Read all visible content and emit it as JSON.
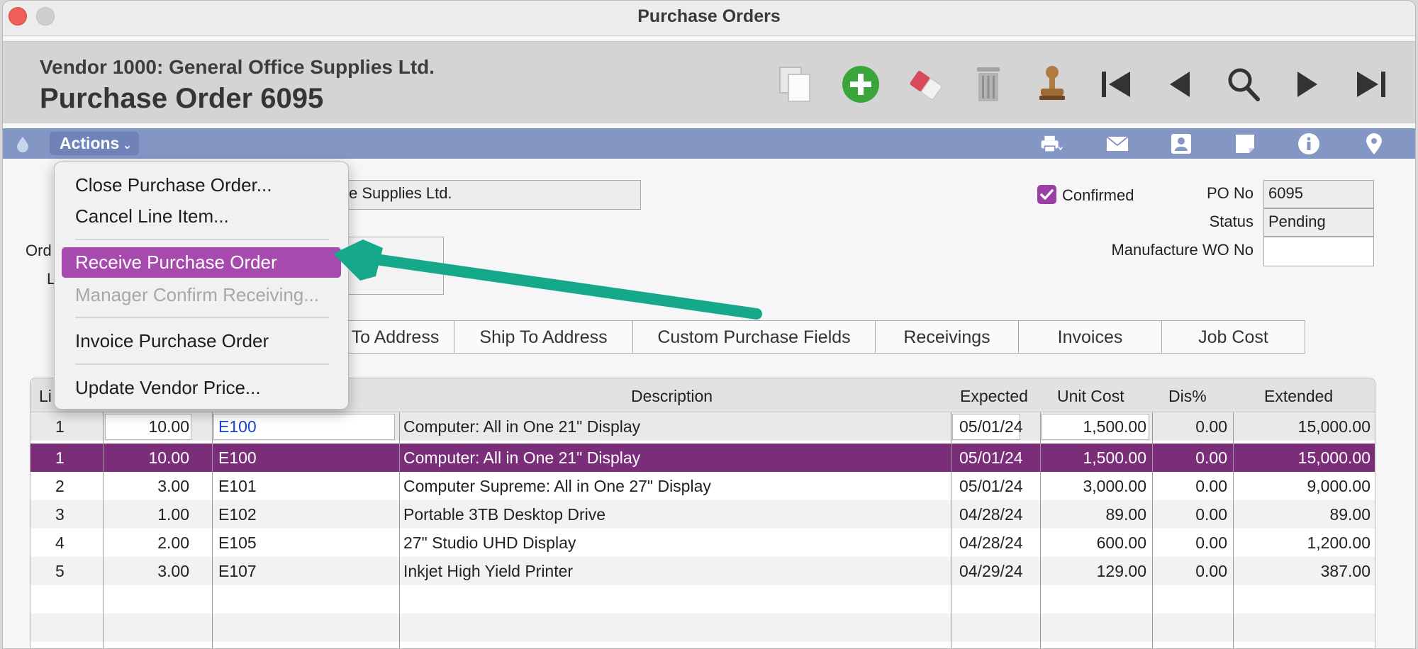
{
  "window": {
    "title": "Purchase Orders"
  },
  "header": {
    "vendor_line": "Vendor 1000: General Office Supplies Ltd.",
    "po_title": "Purchase Order 6095"
  },
  "toolbar": {
    "icons": [
      "duplicate-icon",
      "add-icon",
      "eraser-icon",
      "trash-icon",
      "stamp-icon",
      "first-record-icon",
      "previous-record-icon",
      "search-icon",
      "next-record-icon",
      "last-record-icon"
    ]
  },
  "actionbar": {
    "actions_label": "Actions",
    "icons": [
      "drop-icon",
      "print-icon",
      "mail-icon",
      "contact-icon",
      "note-icon",
      "info-icon",
      "location-icon"
    ]
  },
  "menu": {
    "items": [
      {
        "label": "Close Purchase Order...",
        "enabled": true
      },
      {
        "label": "Cancel Line Item...",
        "enabled": true
      },
      {
        "label": "Receive Purchase Order",
        "enabled": true,
        "highlighted": true
      },
      {
        "label": "Manager Confirm Receiving...",
        "enabled": false
      },
      {
        "label": "Invoice Purchase Order",
        "enabled": true
      },
      {
        "label": "Update Vendor Price...",
        "enabled": true
      }
    ]
  },
  "form": {
    "vendor_name_partial": "ce Supplies Ltd.",
    "left_label_1": "Ord",
    "left_label_2": "L",
    "confirmed_label": "Confirmed",
    "confirmed_checked": true,
    "po_no_label": "PO No",
    "po_no_value": "6095",
    "status_label": "Status",
    "status_value": "Pending",
    "wo_label": "Manufacture WO No",
    "wo_value": ""
  },
  "tabs": [
    "To Address",
    "Ship To Address",
    "Custom Purchase Fields",
    "Receivings",
    "Invoices",
    "Job Cost"
  ],
  "table": {
    "headers": [
      "Li",
      "Description",
      "Expected",
      "Unit Cost",
      "Dis%",
      "Extended"
    ],
    "edit_row": {
      "line": "1",
      "qty": "10.00",
      "item": "E100",
      "description": "Computer: All in One 21\" Display",
      "expected": "05/01/24",
      "unit_cost": "1,500.00",
      "dis": "0.00",
      "extended": "15,000.00"
    },
    "rows": [
      {
        "line": "1",
        "qty": "10.00",
        "item": "E100",
        "description": "Computer: All in One 21\" Display",
        "expected": "05/01/24",
        "unit_cost": "1,500.00",
        "dis": "0.00",
        "extended": "15,000.00"
      },
      {
        "line": "2",
        "qty": "3.00",
        "item": "E101",
        "description": "Computer Supreme: All in One 27\" Display",
        "expected": "05/01/24",
        "unit_cost": "3,000.00",
        "dis": "0.00",
        "extended": "9,000.00"
      },
      {
        "line": "3",
        "qty": "1.00",
        "item": "E102",
        "description": "Portable 3TB Desktop Drive",
        "expected": "04/28/24",
        "unit_cost": "89.00",
        "dis": "0.00",
        "extended": "89.00"
      },
      {
        "line": "4",
        "qty": "2.00",
        "item": "E105",
        "description": "27\" Studio UHD Display",
        "expected": "04/28/24",
        "unit_cost": "600.00",
        "dis": "0.00",
        "extended": "1,200.00"
      },
      {
        "line": "5",
        "qty": "3.00",
        "item": "E107",
        "description": "Inkjet High Yield Printer",
        "expected": "04/29/24",
        "unit_cost": "129.00",
        "dis": "0.00",
        "extended": "387.00"
      }
    ]
  },
  "colors": {
    "accent_purple": "#7a2d78",
    "menu_highlight": "#a64aae",
    "action_bar": "#8396c4",
    "arrow": "#16a88a",
    "add_green": "#3aa53a"
  }
}
